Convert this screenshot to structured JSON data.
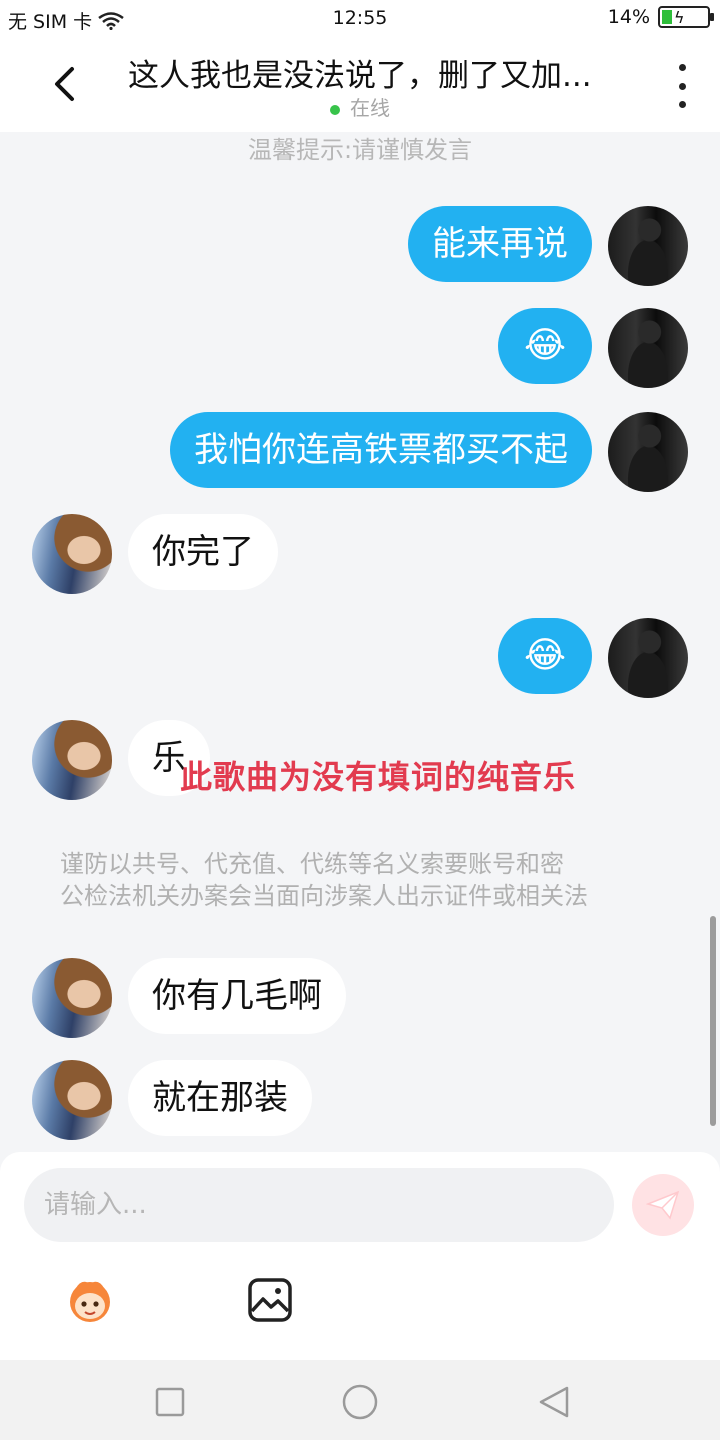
{
  "status_bar": {
    "carrier": "无 SIM 卡",
    "time": "12:55",
    "battery": "14%"
  },
  "header": {
    "title": "这人我也是没法说了，删了又加...",
    "status": "在线"
  },
  "tip": "温馨提示:请谨慎发言",
  "messages": [
    {
      "side": "me",
      "text": "能来再说"
    },
    {
      "side": "me",
      "text": "😂"
    },
    {
      "side": "me",
      "text": "我怕你连高铁票都买不起"
    },
    {
      "side": "other",
      "text": "你完了"
    },
    {
      "side": "me",
      "text": "😂"
    },
    {
      "side": "other",
      "text": "乐"
    },
    {
      "side": "other",
      "text": "你有几毛啊"
    },
    {
      "side": "other",
      "text": "就在那装"
    }
  ],
  "overlay_text": "此歌曲为没有填词的纯音乐",
  "notice": {
    "line1": "谨防以共号、代充值、代练等名义索要账号和密",
    "line2": "公检法机关办案会当面向涉案人出示证件或相关法"
  },
  "composer": {
    "placeholder": "请输入..."
  },
  "colors": {
    "my_bubble": "#22b1f1",
    "online_dot": "#37c34a",
    "overlay": "#e23b4f",
    "send_button": "#ffe2e4"
  },
  "icons": [
    "back-icon",
    "more-icon",
    "send-icon",
    "emoji-face-icon",
    "image-icon",
    "square-nav-icon",
    "circle-nav-icon",
    "triangle-back-nav-icon"
  ]
}
